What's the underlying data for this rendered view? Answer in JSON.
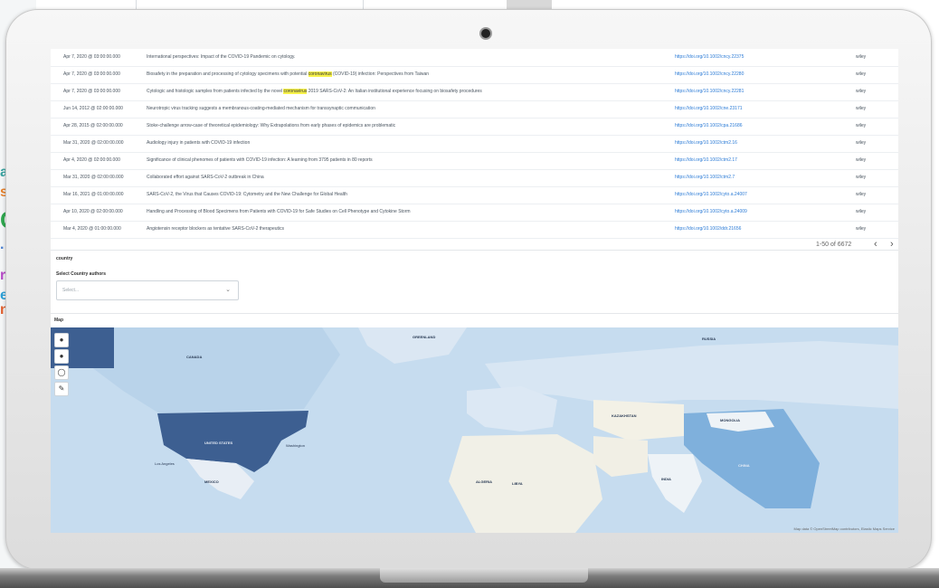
{
  "table": {
    "rows": [
      {
        "date": "Apr 7, 2020 @ 03:00:00.000",
        "title": "International perspectives: Impact of the COVID-19 Pandemic on cytology.",
        "hl": "",
        "title_after": "",
        "url": "https://doi.org/10.1002/cncy.22375",
        "source": "wiley"
      },
      {
        "date": "Apr 7, 2020 @ 03:00:00.000",
        "title": "Biosafety in the preparation and processing of cytology specimens with potential ",
        "hl": "coronavirus",
        "title_after": " (COVID-19) infection: Perspectives from Taiwan",
        "url": "https://doi.org/10.1002/cncy.22280",
        "source": "wiley"
      },
      {
        "date": "Apr 7, 2020 @ 03:00:00.000",
        "title": "Cytologic and histologic samples from patients infected by the novel ",
        "hl": "coronavirus",
        "title_after": " 2019 SARS-CoV-2: An Italian institutional experience focusing on biosafety procedures",
        "url": "https://doi.org/10.1002/cncy.22281",
        "source": "wiley"
      },
      {
        "date": "Jun 14, 2012 @ 02:00:00.000",
        "title": "Neurotropic virus tracking suggests a membranous-coating-mediated mechanism for transsynaptic communication",
        "hl": "",
        "title_after": "",
        "url": "https://doi.org/10.1002/cne.23171",
        "source": "wiley"
      },
      {
        "date": "Apr 28, 2015 @ 02:00:00.000",
        "title": "Stoke-challenge arrow-case of theoretical epidemiology: Why Extrapolations from early phases of epidemics are problematic",
        "hl": "",
        "title_after": "",
        "url": "https://doi.org/10.1002/cpa.21686",
        "source": "wiley"
      },
      {
        "date": "Mar 31, 2020 @ 02:00:00.000",
        "title": "Audiology injury in patients with COVID-19 infection",
        "hl": "",
        "title_after": "",
        "url": "https://doi.org/10.1002/ctm2.16",
        "source": "wiley"
      },
      {
        "date": "Apr 4, 2020 @ 02:00:00.000",
        "title": "Significance of clinical phenomes of patients with COVID-19 infection: A learning from 3795 patients in 80 reports",
        "hl": "",
        "title_after": "",
        "url": "https://doi.org/10.1002/ctm2.17",
        "source": "wiley"
      },
      {
        "date": "Mar 31, 2020 @ 02:00:00.000",
        "title": "Collaborated effort against SARS-CoV-2 outbreak in China",
        "hl": "",
        "title_after": "",
        "url": "https://doi.org/10.1002/ctm2.7",
        "source": "wiley"
      },
      {
        "date": "Mar 16, 2021 @ 01:00:00.000",
        "title": "SARS-CoV-2, the Virus that Causes COVID-19: Cytometry and the New Challenge for Global Health",
        "hl": "",
        "title_after": "",
        "url": "https://doi.org/10.1002/cyto.a.24007",
        "source": "wiley"
      },
      {
        "date": "Apr 10, 2020 @ 02:00:00.000",
        "title": "Handling and Processing of Blood Specimens from Patients with COVID-19 for Safe Studies on Cell Phenotype and Cytokine Storm",
        "hl": "",
        "title_after": "",
        "url": "https://doi.org/10.1002/cyto.a.24009",
        "source": "wiley"
      },
      {
        "date": "Mar 4, 2020 @ 01:00:00.000",
        "title": "Angiotensin receptor blockers as tentative SARS-CoV-2 therapeutics",
        "hl": "",
        "title_after": "",
        "url": "https://doi.org/10.1002/ddr.21656",
        "source": "wiley"
      }
    ]
  },
  "pagination": {
    "text": "1-50 of 6672",
    "prev": "‹",
    "next": "›"
  },
  "country": {
    "section_label": "country",
    "field_label": "Select Country authors",
    "placeholder": "Select..."
  },
  "map": {
    "section_label": "Map",
    "attribution": "Map data © OpenStreetMap contributors, Elastic Maps Service",
    "labels": {
      "usa": "UNITED STATES",
      "canada": "CANADA",
      "greenland": "GREENLAND",
      "russia": "RUSSIA",
      "china": "CHINA",
      "india": "INDIA",
      "mongolia": "MONGOLIA",
      "kazakhstan": "KAZAKHSTAN",
      "algeria": "ALGERIA",
      "libya": "LIBYA",
      "mexico": "MEXICO",
      "washington": "Washington",
      "los_angeles": "Los Angeles"
    }
  },
  "colors": {
    "accent": "#2b7bd6",
    "highlight": "#f7f24a",
    "map_usa": "#3d5f91",
    "map_china": "#7fb0dc",
    "map_ocean": "#c6dcef"
  }
}
